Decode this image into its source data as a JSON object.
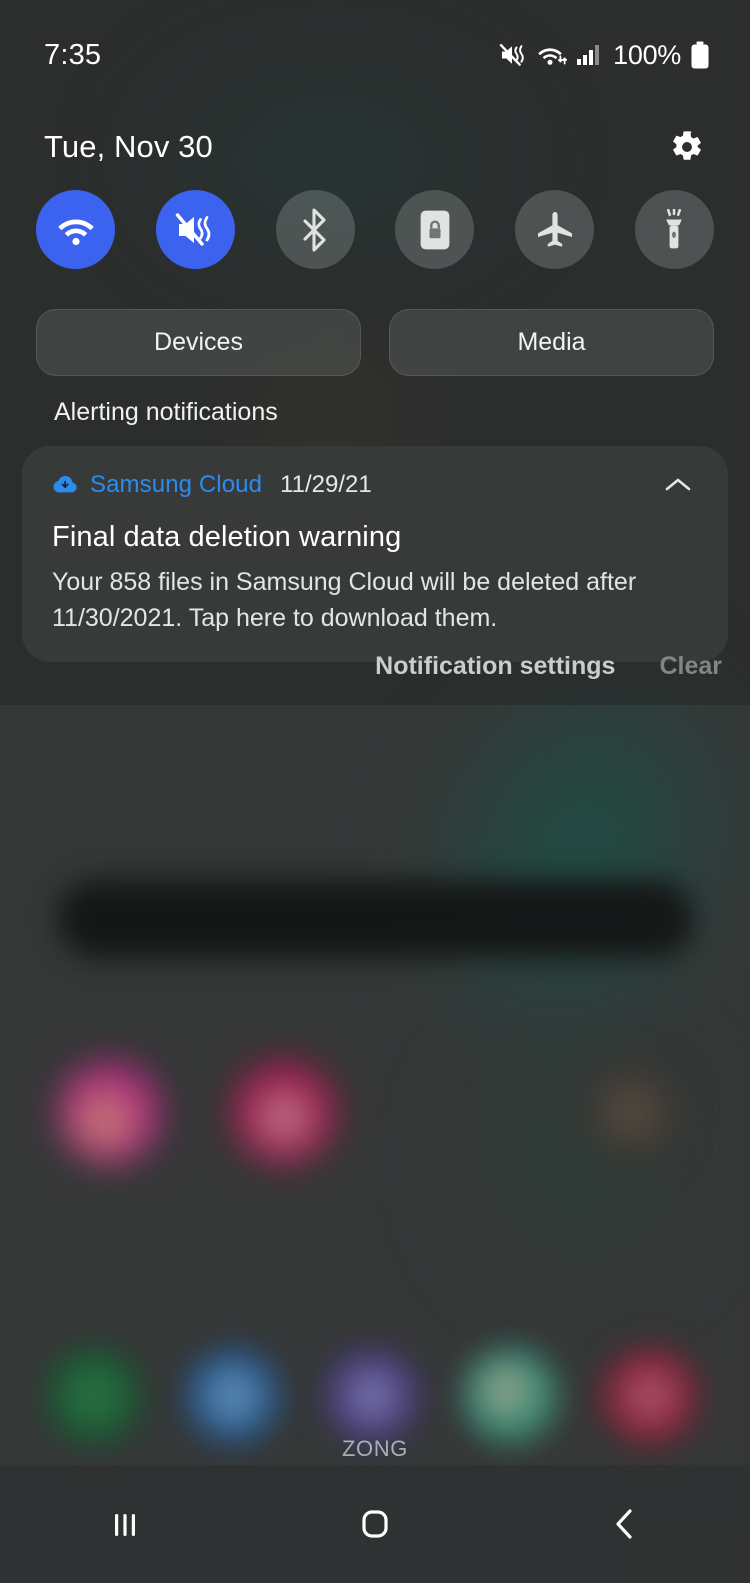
{
  "status_bar": {
    "clock": "7:35",
    "battery_percent": "100%",
    "icons": [
      "mute-vibrate-icon",
      "wifi-data-icon",
      "cellular-signal-icon",
      "battery-icon"
    ]
  },
  "shade_header": {
    "date": "Tue, Nov 30",
    "settings_icon": "gear-icon"
  },
  "quick_settings": {
    "toggles": [
      {
        "name": "wifi",
        "icon": "wifi-icon",
        "state": "on"
      },
      {
        "name": "sound-mode",
        "icon": "mute-icon",
        "state": "on"
      },
      {
        "name": "bluetooth",
        "icon": "bluetooth-icon",
        "state": "off"
      },
      {
        "name": "auto-rotate",
        "icon": "rotation-lock-icon",
        "state": "off"
      },
      {
        "name": "airplane",
        "icon": "airplane-icon",
        "state": "off"
      },
      {
        "name": "flashlight",
        "icon": "flashlight-icon",
        "state": "off"
      }
    ],
    "segments": [
      {
        "label": "Devices"
      },
      {
        "label": "Media"
      }
    ]
  },
  "notifications": {
    "section_label": "Alerting notifications",
    "items": [
      {
        "app": "Samsung Cloud",
        "app_icon": "cloud-download-icon",
        "time": "11/29/21",
        "collapse_icon": "chevron-up-icon",
        "title": "Final data deletion warning",
        "body": "Your 858 files in Samsung Cloud will be deleted after 11/30/2021. Tap here to download them."
      }
    ],
    "actions": {
      "settings_label": "Notification settings",
      "clear_label": "Clear"
    }
  },
  "home_screen": {
    "carrier": "ZONG"
  },
  "nav_bar": {
    "recents_icon": "recents-icon",
    "home_icon": "home-icon",
    "back_icon": "back-icon"
  },
  "colors": {
    "accent_active": "#3b63f0",
    "app_name": "#2b8cf0",
    "panel_bg": "#353737",
    "card_bg": "#383a3a"
  }
}
